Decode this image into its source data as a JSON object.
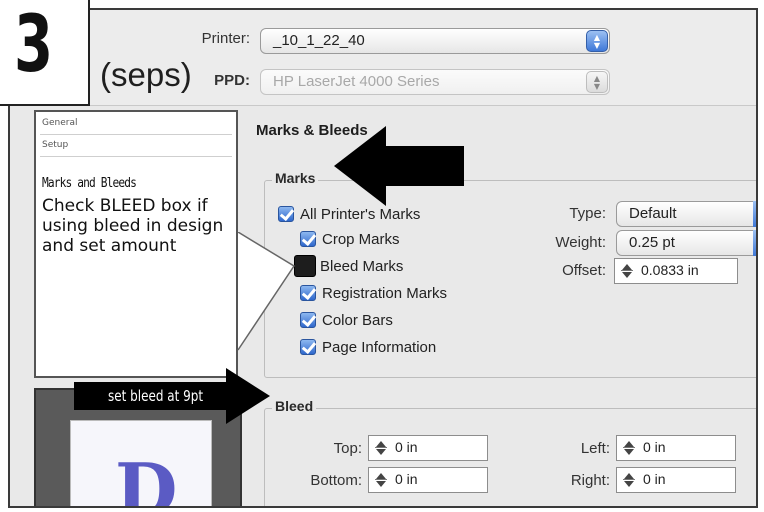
{
  "step_badge": "3",
  "print_dialog": {
    "title_fragment": "(seps)",
    "printer": {
      "label": "Printer:",
      "value": "_10_1_22_40"
    },
    "ppd": {
      "label": "PPD:",
      "value": "HP LaserJet 4000 Series"
    }
  },
  "sidebar": {
    "items": [
      {
        "label": "General"
      },
      {
        "label": "Setup"
      }
    ]
  },
  "callout": {
    "heading": "Marks and Bleeds",
    "body": "Check BLEED box if using bleed in design and set amount"
  },
  "bleed_tag": "set bleed at 9pt",
  "main": {
    "section_title": "Marks & Bleeds",
    "marks": {
      "group_title": "Marks",
      "checkboxes": [
        {
          "label": "All Printer's Marks",
          "checked": true
        },
        {
          "label": "Crop Marks",
          "checked": true
        },
        {
          "label": "Bleed Marks",
          "checked": false
        },
        {
          "label": "Registration Marks",
          "checked": true
        },
        {
          "label": "Color Bars",
          "checked": true
        },
        {
          "label": "Page Information",
          "checked": true
        }
      ],
      "type": {
        "label": "Type:",
        "value": "Default"
      },
      "weight": {
        "label": "Weight:",
        "value": "0.25 pt"
      },
      "offset": {
        "label": "Offset:",
        "value": "0.0833 in"
      }
    },
    "bleed": {
      "group_title": "Bleed",
      "top": {
        "label": "Top:",
        "value": "0 in"
      },
      "bottom": {
        "label": "Bottom:",
        "value": "0 in"
      },
      "left": {
        "label": "Left:",
        "value": "0 in"
      },
      "right": {
        "label": "Right:",
        "value": "0 in"
      }
    }
  },
  "preview": {
    "letter": "D"
  },
  "colors": {
    "accent": "#3f78d8",
    "checkbox_blue": "#2f68cc",
    "preview_letter": "#5b5bc4"
  }
}
